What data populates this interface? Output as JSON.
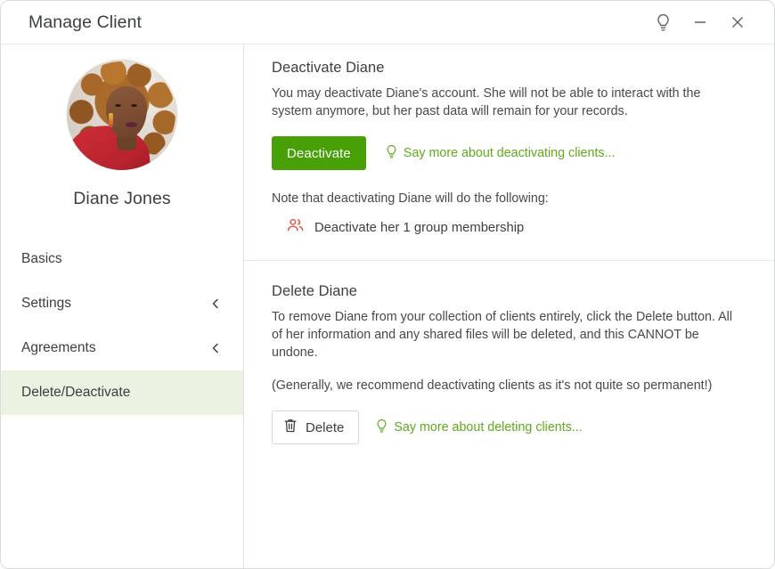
{
  "window": {
    "title": "Manage Client",
    "controls": {
      "help": "lightbulb-icon",
      "minimize": "minimize-icon",
      "close": "close-icon"
    }
  },
  "sidebar": {
    "client_name": "Diane Jones",
    "avatar_alt": "Diane Jones profile photo",
    "items": [
      {
        "label": "Basics",
        "has_chevron": false,
        "active": false
      },
      {
        "label": "Settings",
        "has_chevron": true,
        "chevron": "chevron-left-icon",
        "active": false
      },
      {
        "label": "Agreements",
        "has_chevron": true,
        "chevron": "chevron-left-icon",
        "active": false
      },
      {
        "label": "Delete/Deactivate",
        "has_chevron": false,
        "active": true
      }
    ]
  },
  "main": {
    "deactivate": {
      "title": "Deactivate Diane",
      "description": "You may deactivate Diane's account. She will not be able to interact with the system anymore, but her past data will remain for your records.",
      "button_label": "Deactivate",
      "hint_link": "Say more about deactivating clients...",
      "hint_icon": "lightbulb-icon",
      "note_label": "Note that deactivating Diane will do the following:",
      "note_items": [
        {
          "icon": "group-members-icon",
          "text": "Deactivate her 1 group membership"
        }
      ]
    },
    "delete": {
      "title": "Delete Diane",
      "description": "To remove Diane from your collection of clients entirely, click the Delete button. All of her information and any shared files will be deleted, and this CANNOT be undone.",
      "recommendation": "(Generally, we recommend deactivating clients as it's not quite so permanent!)",
      "button_label": "Delete",
      "button_icon": "trash-icon",
      "hint_link": "Say more about deleting clients...",
      "hint_icon": "lightbulb-icon"
    }
  },
  "colors": {
    "accent_green": "#46a006",
    "link_green": "#5faa1e",
    "active_nav_bg": "#eaf2e2",
    "note_icon_red": "#e04a3f",
    "text_primary": "#3c4043"
  }
}
